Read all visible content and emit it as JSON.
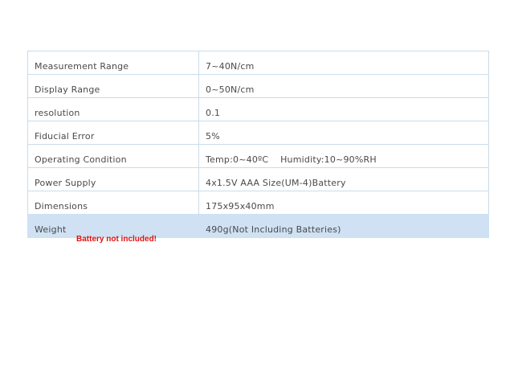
{
  "specs": [
    {
      "label": "Measurement Range",
      "value": "7~40N/cm"
    },
    {
      "label": "Display Range",
      "value": "0~50N/cm"
    },
    {
      "label": "resolution",
      "value": "0.1"
    },
    {
      "label": "Fiducial Error",
      "value": "5%"
    },
    {
      "label": "Operating Condition",
      "value": "Temp:0~40ºC    Humidity:10~90%RH"
    },
    {
      "label": "Power Supply",
      "value": "4x1.5V AAA Size(UM-4)Battery"
    },
    {
      "label": "Dimensions",
      "value": "175x95x40mm"
    },
    {
      "label": "Weight",
      "value": "490g(Not Including Batteries)"
    }
  ],
  "note": "Battery not included!",
  "colors": {
    "highlight_row": "#cfe1f3",
    "border": "#c9dceb",
    "note_text": "#e01010"
  }
}
